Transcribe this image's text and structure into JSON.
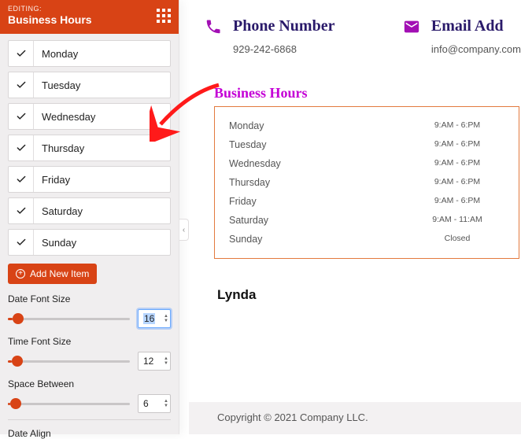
{
  "editor": {
    "editing_label": "EDITING:",
    "block_name": "Business Hours",
    "days": [
      {
        "label": "Monday"
      },
      {
        "label": "Tuesday"
      },
      {
        "label": "Wednesday"
      },
      {
        "label": "Thursday"
      },
      {
        "label": "Friday"
      },
      {
        "label": "Saturday"
      },
      {
        "label": "Sunday"
      }
    ],
    "add_item": "Add New Item",
    "fields": {
      "date_font": {
        "label": "Date Font Size",
        "value": "16",
        "fill_pct": 4
      },
      "time_font": {
        "label": "Time Font Size",
        "value": "12",
        "fill_pct": 3
      },
      "space_between": {
        "label": "Space Between",
        "value": "6",
        "fill_pct": 2
      },
      "date_align": {
        "label": "Date Align"
      }
    }
  },
  "preview": {
    "phone": {
      "label": "Phone Number",
      "value": "929-242-6868"
    },
    "email": {
      "label": "Email Add",
      "value": "info@company.com"
    },
    "bh_title": "Business Hours",
    "hours": [
      {
        "day": "Monday",
        "time": "9:AM - 6:PM"
      },
      {
        "day": "Tuesday",
        "time": "9:AM - 6:PM"
      },
      {
        "day": "Wednesday",
        "time": "9:AM - 6:PM"
      },
      {
        "day": "Thursday",
        "time": "9:AM - 6:PM"
      },
      {
        "day": "Friday",
        "time": "9:AM - 6:PM"
      },
      {
        "day": "Saturday",
        "time": "9:AM - 11:AM"
      },
      {
        "day": "Sunday",
        "time": "Closed"
      }
    ],
    "author": "Lynda",
    "copyright": "Copyright © 2021 Company LLC."
  }
}
